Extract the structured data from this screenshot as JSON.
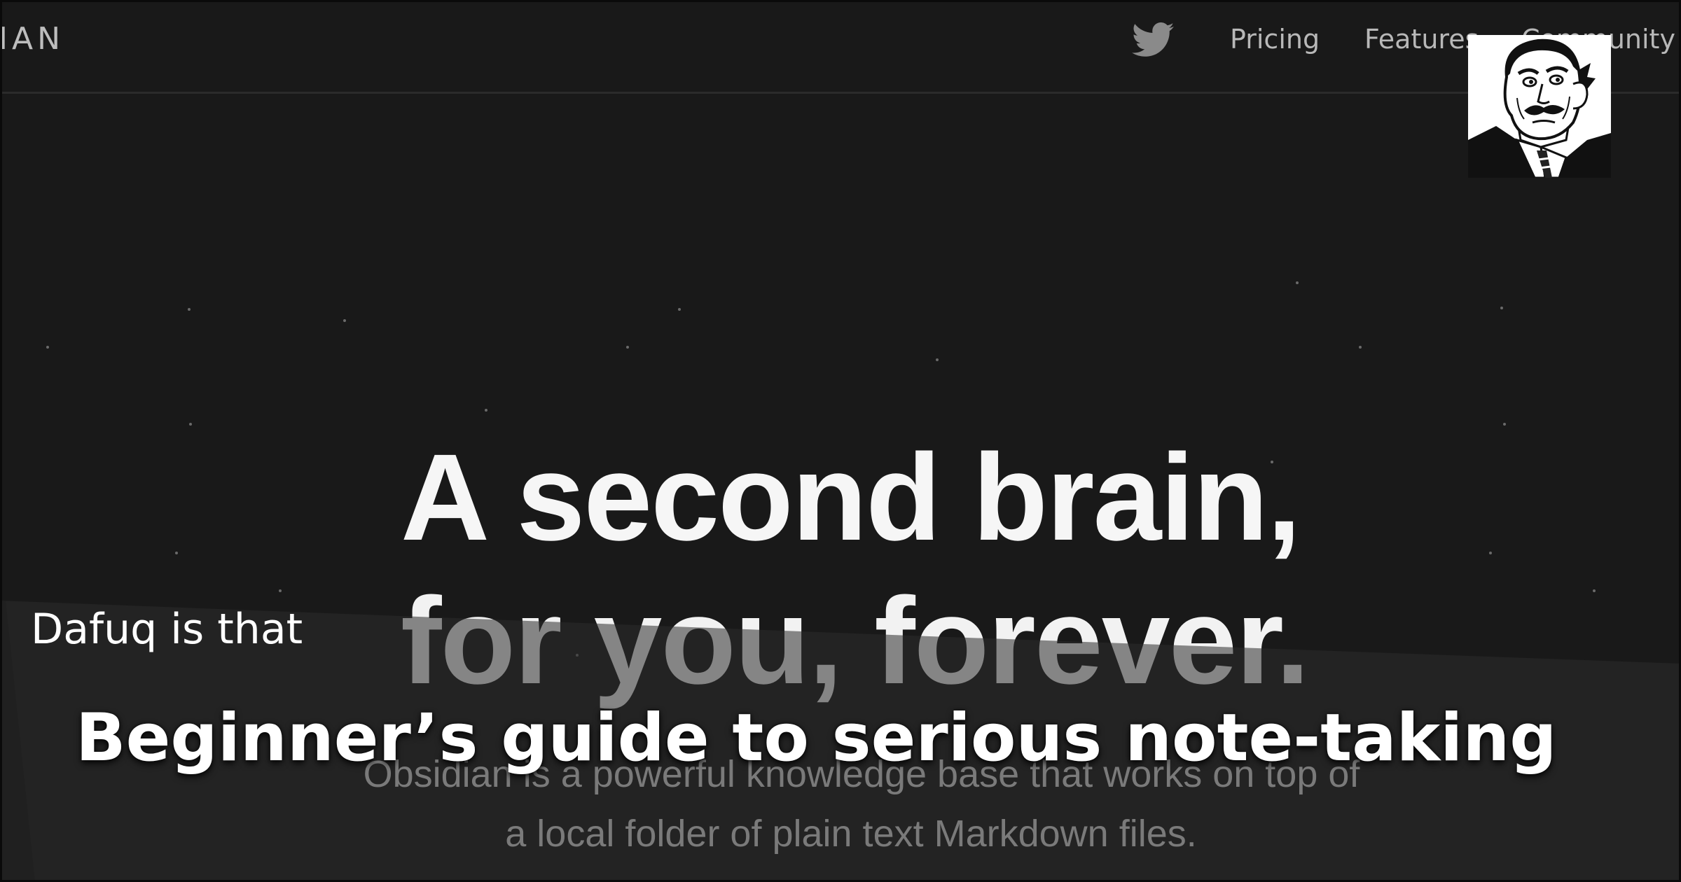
{
  "nav": {
    "brand": "IAN",
    "twitter_icon": "twitter-bird-icon",
    "links": [
      "Pricing",
      "Features",
      "Community"
    ]
  },
  "hero": {
    "line1": "A second brain,",
    "line2": "for you, forever.",
    "subtitle_line1": "Obsidian is a powerful knowledge base that works on top of",
    "subtitle_line2": "a local folder of plain text Markdown files."
  },
  "meme": {
    "face": "meme-face-image",
    "caption_small": "Dafuq is that",
    "caption_big": "Beginner’s guide to serious note-taking"
  },
  "colors": {
    "background": "#191919",
    "overlay": "#2a2a2a",
    "hero_text": "#f6f6f6",
    "nav_text": "#b8b8b8"
  }
}
